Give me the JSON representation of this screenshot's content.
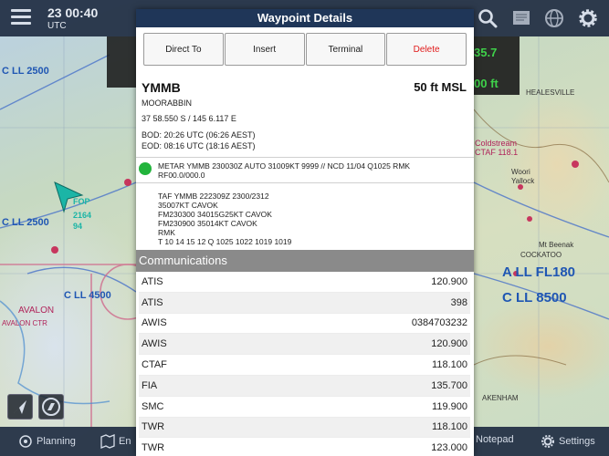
{
  "topbar": {
    "time": "23 00:40",
    "zone": "UTC"
  },
  "telemetry": {
    "value_top": "35.7",
    "value_bottom": "00 ft"
  },
  "map_labels": {
    "cll_2500_left": "C LL 2500",
    "cll_2500_mid": "C LL 2500",
    "cll_4500": "C LL 4500",
    "all_fl180": "A LL FL180",
    "cll_8500": "C LL 8500",
    "healesville": "HEALESVILLE",
    "coldstream": "Coldstream",
    "ctaf": "CTAF 118.1",
    "woori": "Woori",
    "yallock": "Yallock",
    "avalon": "AVALON",
    "avalon_ctr": "AVALON CTR",
    "beenak": "Mt Beenak",
    "cockatoo": "COCKATOO",
    "akenham": "AKENHAM",
    "fop": "FOP",
    "aircraft_code1": "2164",
    "aircraft_code2": "94"
  },
  "bottombar": {
    "planning": "Planning",
    "enroute": "En",
    "notepad": "Notepad",
    "settings": "Settings"
  },
  "modal": {
    "title": "Waypoint Details",
    "buttons": {
      "direct_to": "Direct To",
      "insert": "Insert",
      "terminal": "Terminal",
      "delete": "Delete"
    },
    "waypoint": {
      "code": "YMMB",
      "elevation": "50 ft MSL",
      "name": "MOORABBIN",
      "coords": "37 58.550 S / 145 6.117 E",
      "bod": "BOD: 20:26 UTC (06:26 AEST)",
      "eod": "EOD: 08:16 UTC (18:16 AEST)"
    },
    "metar": {
      "line1": "METAR YMMB 230030Z AUTO 31009KT 9999 // NCD 11/04 Q1025 RMK",
      "line2": "RF00.0/000.0"
    },
    "taf": {
      "line1": "TAF YMMB 222309Z 2300/2312",
      "line2": "35007KT CAVOK",
      "line3": "FM230300 34015G25KT CAVOK",
      "line4": "FM230900 35014KT CAVOK",
      "line5": "RMK",
      "line6": "T 10 14 15 12 Q 1025 1022 1019 1019"
    },
    "communications": {
      "heading": "Communications",
      "rows": [
        {
          "type": "ATIS",
          "freq": "120.900"
        },
        {
          "type": "ATIS",
          "freq": "398"
        },
        {
          "type": "AWIS",
          "freq": "0384703232"
        },
        {
          "type": "AWIS",
          "freq": "120.900"
        },
        {
          "type": "CTAF",
          "freq": "118.100"
        },
        {
          "type": "FIA",
          "freq": "135.700"
        },
        {
          "type": "SMC",
          "freq": "119.900"
        },
        {
          "type": "TWR",
          "freq": "118.100"
        },
        {
          "type": "TWR",
          "freq": "123.000"
        }
      ]
    }
  },
  "colors": {
    "header": "#1f3658",
    "delete": "#e11b1b",
    "metar_status": "#22b43c",
    "section": "#8a8a8a",
    "telemetry": "#3fd14a"
  }
}
